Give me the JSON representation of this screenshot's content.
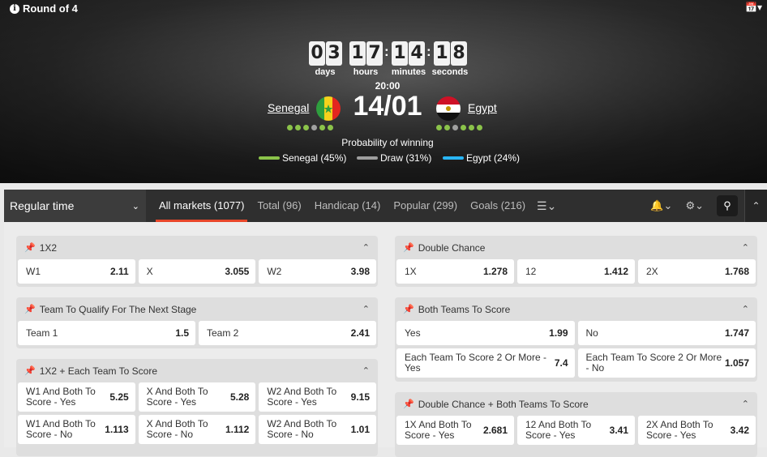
{
  "header": {
    "round": "Round of 4",
    "countdown": {
      "days": [
        "0",
        "3"
      ],
      "hours": [
        "1",
        "7"
      ],
      "minutes": [
        "1",
        "4"
      ],
      "seconds": [
        "1",
        "8"
      ],
      "labels": {
        "days": "days",
        "hours": "hours",
        "minutes": "minutes",
        "seconds": "seconds"
      }
    },
    "time": "20:00",
    "score": "14/01",
    "home": {
      "name": "Senegal",
      "form": [
        "win",
        "win",
        "win",
        "draw",
        "win",
        "win"
      ]
    },
    "away": {
      "name": "Egypt",
      "form": [
        "win",
        "win",
        "draw",
        "win",
        "win",
        "win"
      ]
    },
    "probability_title": "Probability of winning",
    "probabilities": [
      {
        "label": "Senegal (45%)",
        "color": "#8bc34a"
      },
      {
        "label": "Draw (31%)",
        "color": "#9e9e9e"
      },
      {
        "label": "Egypt (24%)",
        "color": "#29b6f6"
      }
    ]
  },
  "tabs_bar": {
    "period": "Regular time",
    "tabs": [
      "All markets (1077)",
      "Total (96)",
      "Handicap (14)",
      "Popular (299)",
      "Goals (216)"
    ]
  },
  "markets": {
    "m1x2": {
      "title": "1X2",
      "outcomes": [
        {
          "label": "W1",
          "odd": "2.11"
        },
        {
          "label": "X",
          "odd": "3.055"
        },
        {
          "label": "W2",
          "odd": "3.98"
        }
      ]
    },
    "qualify": {
      "title": "Team To Qualify For The Next Stage",
      "outcomes": [
        {
          "label": "Team 1",
          "odd": "1.5"
        },
        {
          "label": "Team 2",
          "odd": "2.41"
        }
      ]
    },
    "each": {
      "title": "1X2 + Each Team To Score",
      "outcomes": [
        {
          "label": "W1 And Both To Score - Yes",
          "odd": "5.25"
        },
        {
          "label": "X And Both To Score - Yes",
          "odd": "5.28"
        },
        {
          "label": "W2 And Both To Score - Yes",
          "odd": "9.15"
        },
        {
          "label": "W1 And Both To Score - No",
          "odd": "1.113"
        },
        {
          "label": "X And Both To Score - No",
          "odd": "1.112"
        },
        {
          "label": "W2 And Both To Score - No",
          "odd": "1.01"
        }
      ]
    },
    "dc": {
      "title": "Double Chance",
      "outcomes": [
        {
          "label": "1X",
          "odd": "1.278"
        },
        {
          "label": "12",
          "odd": "1.412"
        },
        {
          "label": "2X",
          "odd": "1.768"
        }
      ]
    },
    "btts": {
      "title": "Both Teams To Score",
      "outcomes": [
        {
          "label": "Yes",
          "odd": "1.99"
        },
        {
          "label": "No",
          "odd": "1.747"
        },
        {
          "label": "Each Team To Score 2 Or More - Yes",
          "odd": "7.4"
        },
        {
          "label": "Each Team To Score 2 Or More - No",
          "odd": "1.057"
        }
      ]
    },
    "dcbtts": {
      "title": "Double Chance + Both Teams To Score",
      "outcomes": [
        {
          "label": "1X And Both To Score - Yes",
          "odd": "2.681"
        },
        {
          "label": "12 And Both To Score - Yes",
          "odd": "3.41"
        },
        {
          "label": "2X And Both To Score - Yes",
          "odd": "3.42"
        }
      ]
    }
  },
  "colors": {
    "accent": "#e8472a",
    "win": "#8bc34a",
    "draw": "#9e9e9e",
    "egypt": "#29b6f6"
  }
}
